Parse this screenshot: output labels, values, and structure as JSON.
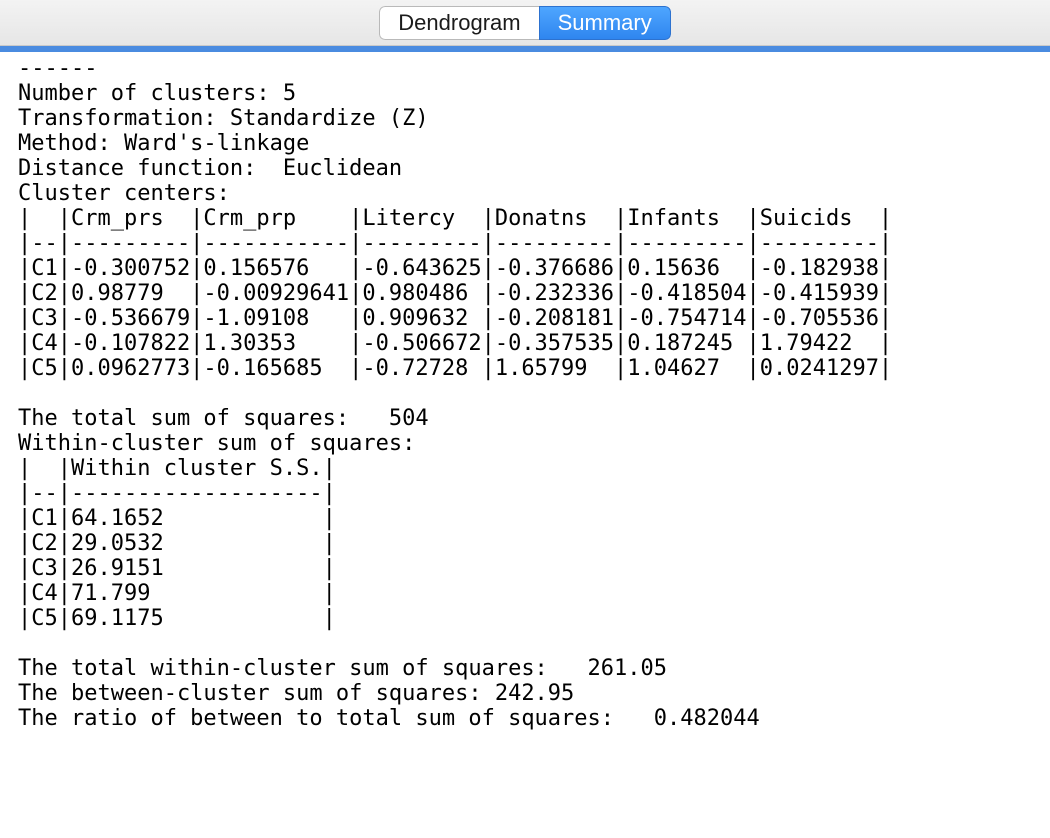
{
  "tabs": {
    "dendrogram": "Dendrogram",
    "summary": "Summary"
  },
  "dashes": "------",
  "labels": {
    "num_clusters": "Number of clusters:",
    "transformation": "Transformation:",
    "method": "Method:",
    "distance_fn": "Distance function:",
    "cluster_centers": "Cluster centers:",
    "total_ss": "The total sum of squares:",
    "within_ss_header": "Within-cluster sum of squares:",
    "within_col": "Within cluster S.S.",
    "total_within": "The total within-cluster sum of squares:",
    "between": "The between-cluster sum of squares:",
    "ratio": "The ratio of between to total sum of squares:"
  },
  "values": {
    "num_clusters": "5",
    "transformation": "Standardize (Z)",
    "method": "Ward's-linkage",
    "distance_fn": "Euclidean",
    "total_ss": "504",
    "total_within": "261.05",
    "between": "242.95",
    "ratio": "0.482044"
  },
  "centers": {
    "cols": [
      "Crm_prs",
      "Crm_prp",
      "Litercy",
      "Donatns",
      "Infants",
      "Suicids"
    ],
    "rows": [
      {
        "id": "C1",
        "v": [
          "-0.300752",
          "0.156576",
          "-0.643625",
          "-0.376686",
          "0.15636",
          "-0.182938"
        ]
      },
      {
        "id": "C2",
        "v": [
          "0.98779",
          "-0.00929641",
          "0.980486",
          "-0.232336",
          "-0.418504",
          "-0.415939"
        ]
      },
      {
        "id": "C3",
        "v": [
          "-0.536679",
          "-1.09108",
          "0.909632",
          "-0.208181",
          "-0.754714",
          "-0.705536"
        ]
      },
      {
        "id": "C4",
        "v": [
          "-0.107822",
          "1.30353",
          "-0.506672",
          "-0.357535",
          "0.187245",
          "1.79422"
        ]
      },
      {
        "id": "C5",
        "v": [
          "0.0962773",
          "-0.165685",
          "-0.72728",
          "1.65799",
          "1.04627",
          "0.0241297"
        ]
      }
    ]
  },
  "within": [
    {
      "id": "C1",
      "v": "64.1652"
    },
    {
      "id": "C2",
      "v": "29.0532"
    },
    {
      "id": "C3",
      "v": "26.9151"
    },
    {
      "id": "C4",
      "v": "71.799"
    },
    {
      "id": "C5",
      "v": "69.1175"
    }
  ]
}
